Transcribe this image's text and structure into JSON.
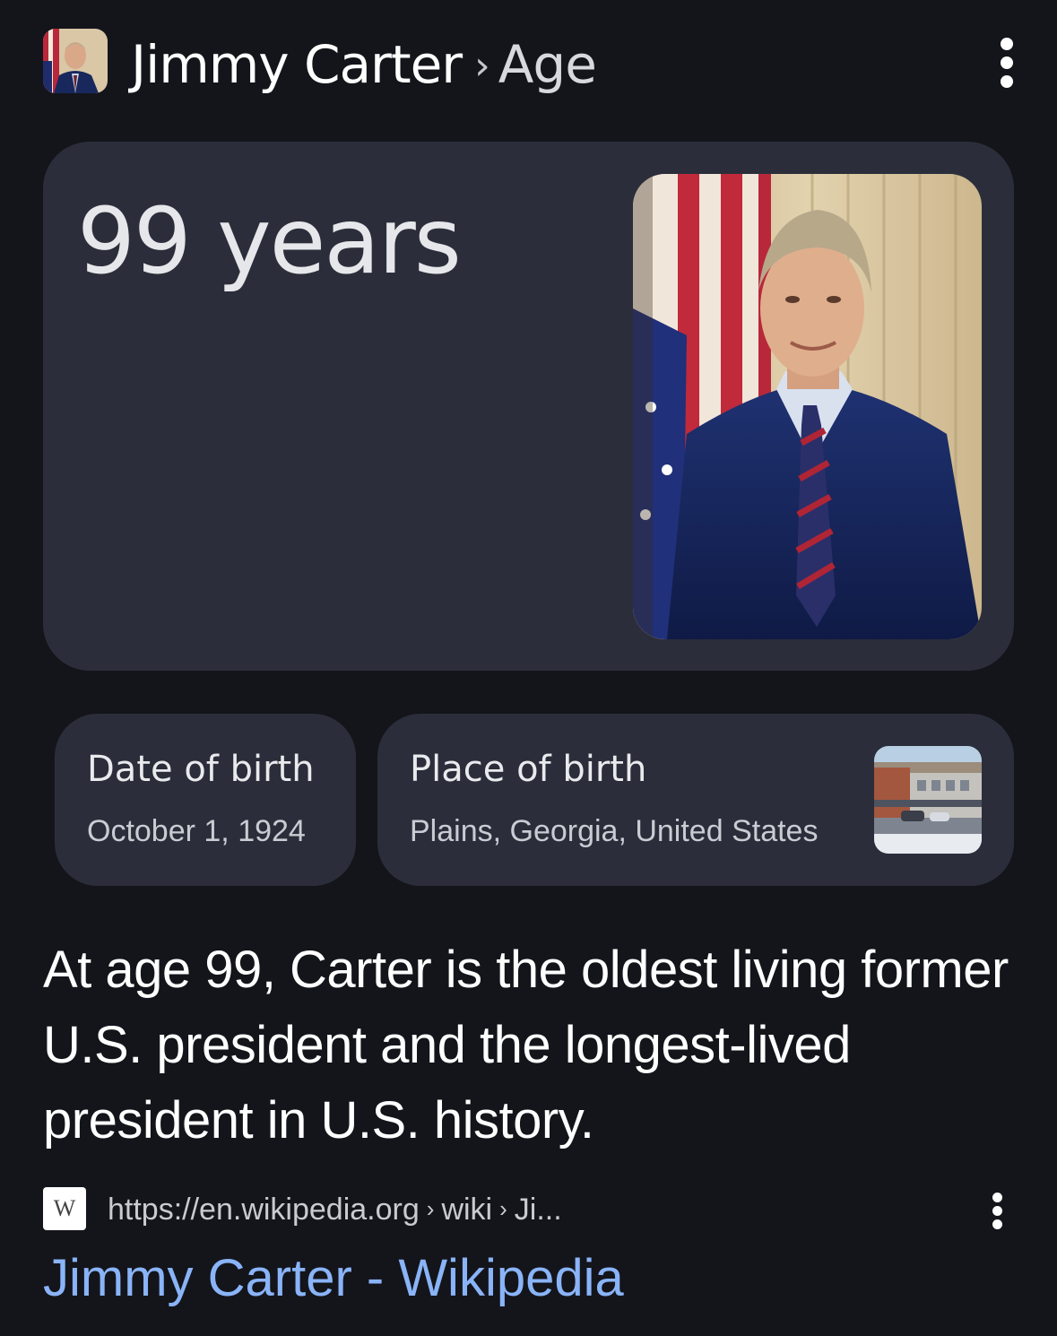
{
  "header": {
    "entity": "Jimmy Carter",
    "separator": "›",
    "attribute": "Age",
    "thumb_icon": "portrait-thumbnail",
    "menu_icon": "more-vert-icon"
  },
  "answer": {
    "value": "99 years",
    "image_icon": "portrait-photo"
  },
  "facts": [
    {
      "label": "Date of birth",
      "value": "October 1, 1924"
    },
    {
      "label": "Place of birth",
      "value": "Plains, Georgia, United States",
      "image_icon": "street-photo"
    }
  ],
  "description": "At age 99, Carter is the oldest living former U.S. president and the longest-lived president in U.S. history.",
  "source": {
    "favicon_letter": "W",
    "url_base": "https://en.wikipedia.org",
    "url_sep": "›",
    "url_part1": "wiki",
    "url_part2": "Ji...",
    "menu_icon": "more-vert-icon",
    "title": "Jimmy Carter - Wikipedia"
  },
  "colors": {
    "background": "#14151b",
    "card": "#2b2e3a",
    "link": "#8ab4f8"
  }
}
